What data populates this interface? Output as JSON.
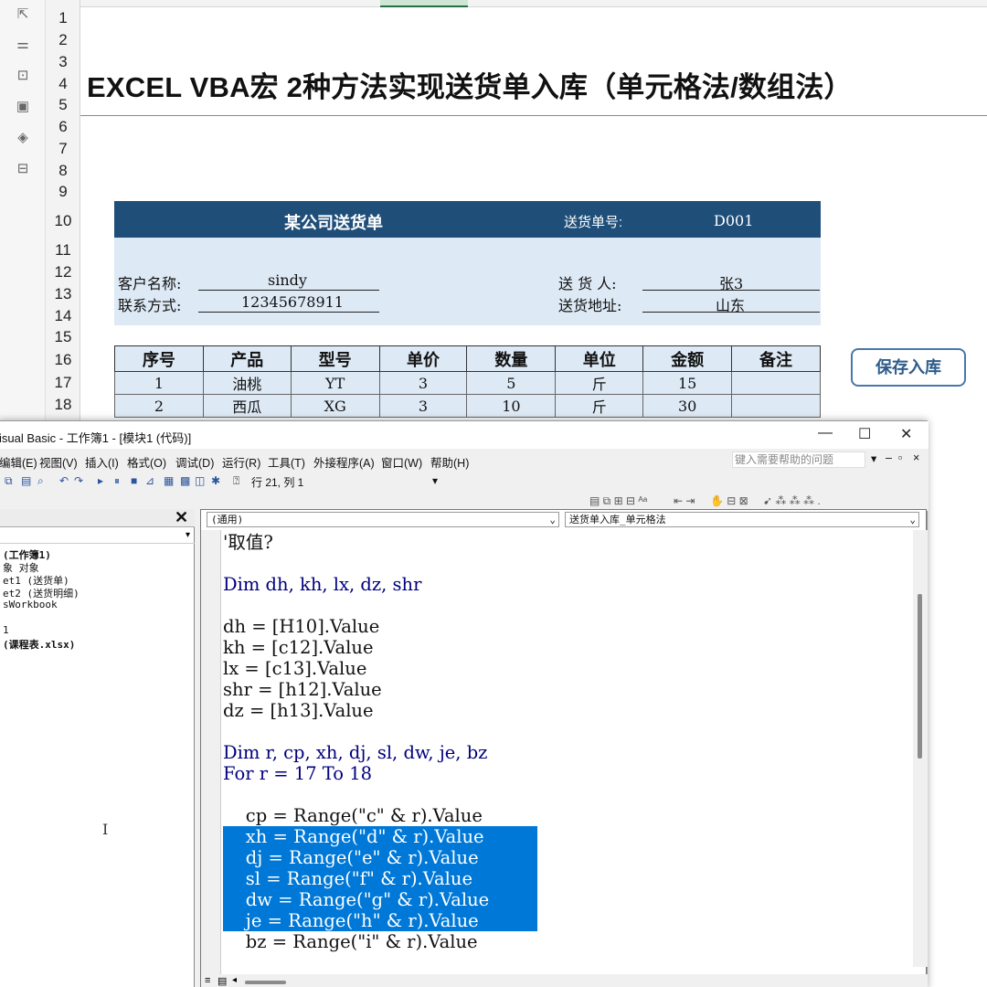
{
  "row_numbers": [
    "1",
    "2",
    "3",
    "4",
    "5",
    "6",
    "7",
    "8",
    "9",
    "10",
    "11",
    "12",
    "13",
    "14",
    "15",
    "16",
    "17",
    "18"
  ],
  "sheet": {
    "title": "EXCEL VBA宏 2种方法实现送货单入库（单元格法/数组法）",
    "form_title": "某公司送货单",
    "order_no_label": "送货单号:",
    "order_no": "D001",
    "customer_label": "客户名称:",
    "customer": "sindy",
    "contact_label": "联系方式:",
    "contact": "12345678911",
    "deliverer_label": "送 货 人:",
    "deliverer": "张3",
    "address_label": "送货地址:",
    "address": "山东",
    "headers": [
      "序号",
      "产品",
      "型号",
      "单价",
      "数量",
      "单位",
      "金额",
      "备注"
    ],
    "rows": [
      [
        "1",
        "油桃",
        "YT",
        "3",
        "5",
        "斤",
        "15",
        ""
      ],
      [
        "2",
        "西瓜",
        "XG",
        "3",
        "10",
        "斤",
        "30",
        ""
      ]
    ],
    "save_button": "保存入库"
  },
  "vbe": {
    "title": "isual Basic - 工作簿1 - [模块1 (代码)]",
    "minimize": "—",
    "maximize": "☐",
    "close": "✕",
    "menu": [
      "编辑(E)",
      "视图(V)",
      "插入(I)",
      "格式(O)",
      "调试(D)",
      "运行(R)",
      "工具(T)",
      "外接程序(A)",
      "窗口(W)",
      "帮助(H)"
    ],
    "help_placeholder": "键入需要帮助的问题",
    "position": "行 21, 列 1",
    "project_close": "✕",
    "project_items": [
      " (工作簿1)",
      "象 对象",
      "et1 (送货单)",
      "et2 (送货明细)",
      "sWorkbook",
      "",
      "1",
      " (课程表.xlsx)"
    ],
    "combo_left": "(通用)",
    "combo_right": "送货单入库_单元格法",
    "code_lines": [
      {
        "text": "'取值?",
        "kw": false,
        "sel": false
      },
      {
        "text": "",
        "kw": false,
        "sel": false
      },
      {
        "text": "Dim dh, kh, lx, dz, shr",
        "kw": true,
        "sel": false
      },
      {
        "text": "",
        "kw": false,
        "sel": false
      },
      {
        "text": "dh = [H10].Value",
        "kw": false,
        "sel": false
      },
      {
        "text": "kh = [c12].Value",
        "kw": false,
        "sel": false
      },
      {
        "text": "lx = [c13].Value",
        "kw": false,
        "sel": false
      },
      {
        "text": "shr = [h12].Value",
        "kw": false,
        "sel": false
      },
      {
        "text": "dz = [h13].Value",
        "kw": false,
        "sel": false
      },
      {
        "text": "",
        "kw": false,
        "sel": false
      },
      {
        "text": "Dim r, cp, xh, dj, sl, dw, je, bz",
        "kw": true,
        "sel": false
      },
      {
        "text": "For r = 17 To 18",
        "kw": true,
        "sel": false
      },
      {
        "text": "",
        "kw": false,
        "sel": false
      },
      {
        "text": "    cp = Range(\"c\" & r).Value",
        "kw": false,
        "sel": false
      },
      {
        "text": "    xh = Range(\"d\" & r).Value",
        "kw": false,
        "sel": true
      },
      {
        "text": "    dj = Range(\"e\" & r).Value",
        "kw": false,
        "sel": true
      },
      {
        "text": "    sl = Range(\"f\" & r).Value",
        "kw": false,
        "sel": true
      },
      {
        "text": "    dw = Range(\"g\" & r).Value",
        "kw": false,
        "sel": true
      },
      {
        "text": "    je = Range(\"h\" & r).Value",
        "kw": false,
        "sel": true
      },
      {
        "text": "    bz = Range(\"i\" & r).Value",
        "kw": false,
        "sel": false
      }
    ]
  },
  "text_cursor": "I"
}
